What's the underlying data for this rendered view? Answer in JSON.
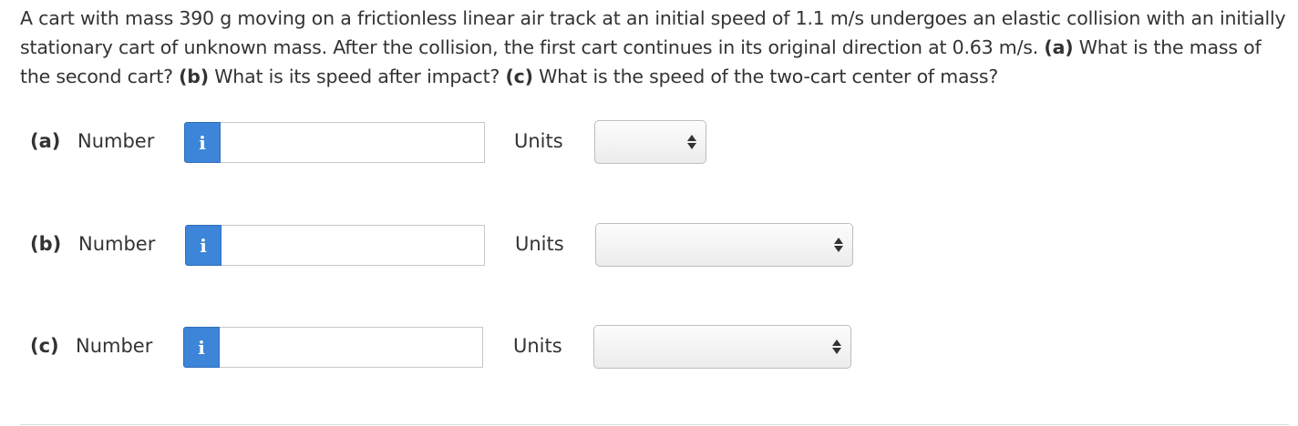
{
  "problem": {
    "text_intro": "A cart with mass 390 g moving on a frictionless linear air track at an initial speed of 1.1 m/s undergoes an elastic collision with an initially stationary cart of unknown mass. After the collision, the first cart continues in its original direction at 0.63 m/s. ",
    "part_a_marker": "(a)",
    "part_a_text": " What is the mass of the second cart? ",
    "part_b_marker": "(b)",
    "part_b_text": " What is its speed after impact? ",
    "part_c_marker": "(c)",
    "part_c_text": " What is the speed of the two-cart center of mass?"
  },
  "answers": [
    {
      "part": "(a)",
      "number_label": "Number",
      "info_icon": "i",
      "number_value": "",
      "units_label": "Units",
      "units_selected": ""
    },
    {
      "part": "(b)",
      "number_label": "Number",
      "info_icon": "i",
      "number_value": "",
      "units_label": "Units",
      "units_selected": ""
    },
    {
      "part": "(c)",
      "number_label": "Number",
      "info_icon": "i",
      "number_value": "",
      "units_label": "Units",
      "units_selected": ""
    }
  ],
  "icons": {
    "info": "info-icon",
    "select_arrows": "up-down-arrows-icon"
  },
  "colors": {
    "info_button": "#3d85d8",
    "text": "#333333",
    "border": "#c8c8c8"
  }
}
